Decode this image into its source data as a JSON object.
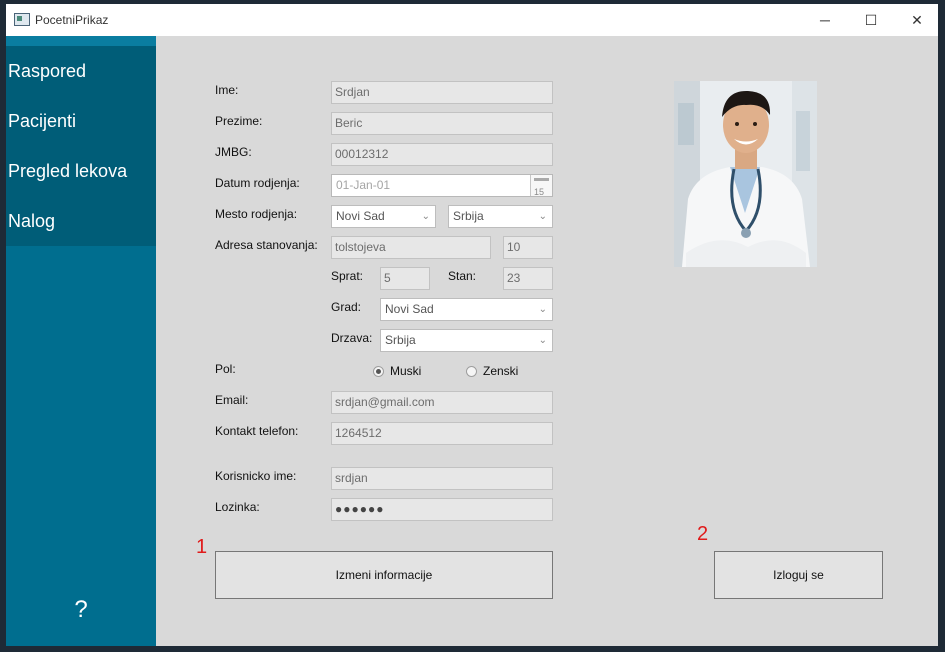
{
  "window": {
    "title": "PocetniPrikaz"
  },
  "icons": {
    "minimize": "─",
    "maximize": "☐",
    "close": "✕",
    "chevron": "⌄",
    "calendar_day": "15"
  },
  "sidebar": {
    "items": [
      {
        "label": "Raspored"
      },
      {
        "label": "Pacijenti"
      },
      {
        "label": "Pregled lekova"
      },
      {
        "label": "Nalog"
      }
    ],
    "help": "?"
  },
  "form": {
    "ime": {
      "label": "Ime:",
      "value": "Srdjan"
    },
    "prezime": {
      "label": "Prezime:",
      "value": "Beric"
    },
    "jmbg": {
      "label": "JMBG:",
      "value": "00012312"
    },
    "datum": {
      "label": "Datum rodjenja:",
      "value": "01-Jan-01"
    },
    "mesto": {
      "label": "Mesto rodjenja:",
      "city": "Novi Sad",
      "country": "Srbija"
    },
    "adresa": {
      "label": "Adresa stanovanja:",
      "street": "tolstojeva",
      "number": "10"
    },
    "sprat": {
      "label": "Sprat:",
      "value": "5"
    },
    "stan": {
      "label": "Stan:",
      "value": "23"
    },
    "grad": {
      "label": "Grad:",
      "value": "Novi Sad"
    },
    "drzava": {
      "label": "Drzava:",
      "value": "Srbija"
    },
    "pol": {
      "label": "Pol:",
      "options": [
        "Muski",
        "Zenski"
      ],
      "selected": "Muski"
    },
    "email": {
      "label": "Email:",
      "value": "srdjan@gmail.com"
    },
    "telefon": {
      "label": "Kontakt telefon:",
      "value": "1264512"
    },
    "korisnicko": {
      "label": "Korisnicko ime:",
      "value": "srdjan"
    },
    "lozinka": {
      "label": "Lozinka:",
      "value": "●●●●●●"
    }
  },
  "buttons": {
    "edit": "Izmeni informacije",
    "logout": "Izloguj se"
  },
  "markers": {
    "m1": "1",
    "m2": "2"
  }
}
